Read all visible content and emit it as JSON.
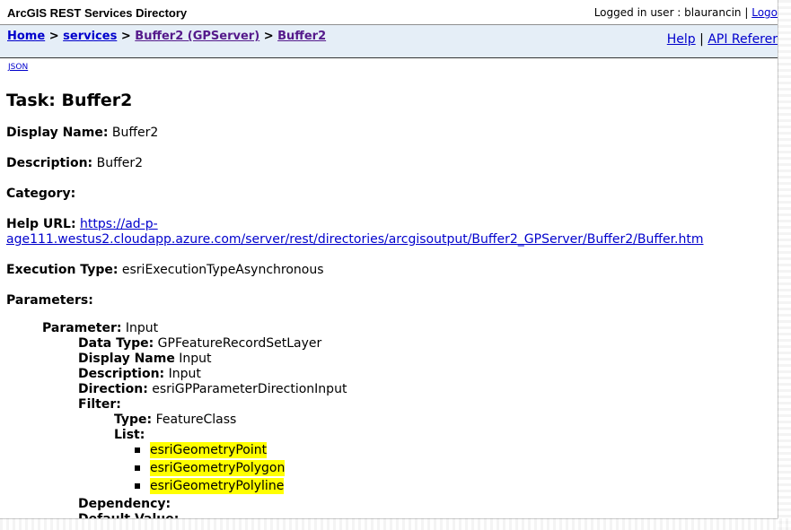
{
  "header": {
    "app_title": "ArcGIS REST Services Directory",
    "logged_in_prefix": "Logged in user : blaurancin",
    "separator": "|",
    "logout_label": "Logo"
  },
  "breadcrumb": {
    "home": "Home",
    "sep": ">",
    "services": "services",
    "gpserver": "Buffer2 (GPServer)",
    "task": "Buffer2"
  },
  "help": {
    "help_label": "Help",
    "separator": "|",
    "api_label": "API Referer"
  },
  "json_link": "JSON",
  "task": {
    "title": "Task: Buffer2",
    "display_name_label": "Display Name:",
    "display_name": "Buffer2",
    "description_label": "Description:",
    "description": "Buffer2",
    "category_label": "Category:",
    "help_url_label": "Help URL:",
    "help_url_line1": "https://ad-p-",
    "help_url_line2": "age111.westus2.cloudapp.azure.com/server/rest/directories/arcgisoutput/Buffer2_GPServer/Buffer2/Buffer.htm",
    "execution_type_label": "Execution Type:",
    "execution_type": "esriExecutionTypeAsynchronous",
    "parameters_label": "Parameters:"
  },
  "parameter": {
    "parameter_label": "Parameter:",
    "parameter_value": "Input",
    "data_type_label": "Data Type:",
    "data_type": "GPFeatureRecordSetLayer",
    "display_name_label": "Display Name",
    "display_name": "Input",
    "description_label": "Description:",
    "description": "Input",
    "direction_label": "Direction:",
    "direction": "esriGPParameterDirectionInput",
    "filter_label": "Filter:",
    "type_label": "Type:",
    "type": "FeatureClass",
    "list_label": "List:",
    "list_items": [
      "esriGeometryPoint",
      "esriGeometryPolygon",
      "esriGeometryPolyline"
    ],
    "dependency_label": "Dependency:",
    "default_value_label": "Default Value:"
  },
  "colors": {
    "link": "#0000cc",
    "visited_link": "#551a8b",
    "nav_background": "#e5eef7",
    "highlight": "#ffff00"
  }
}
